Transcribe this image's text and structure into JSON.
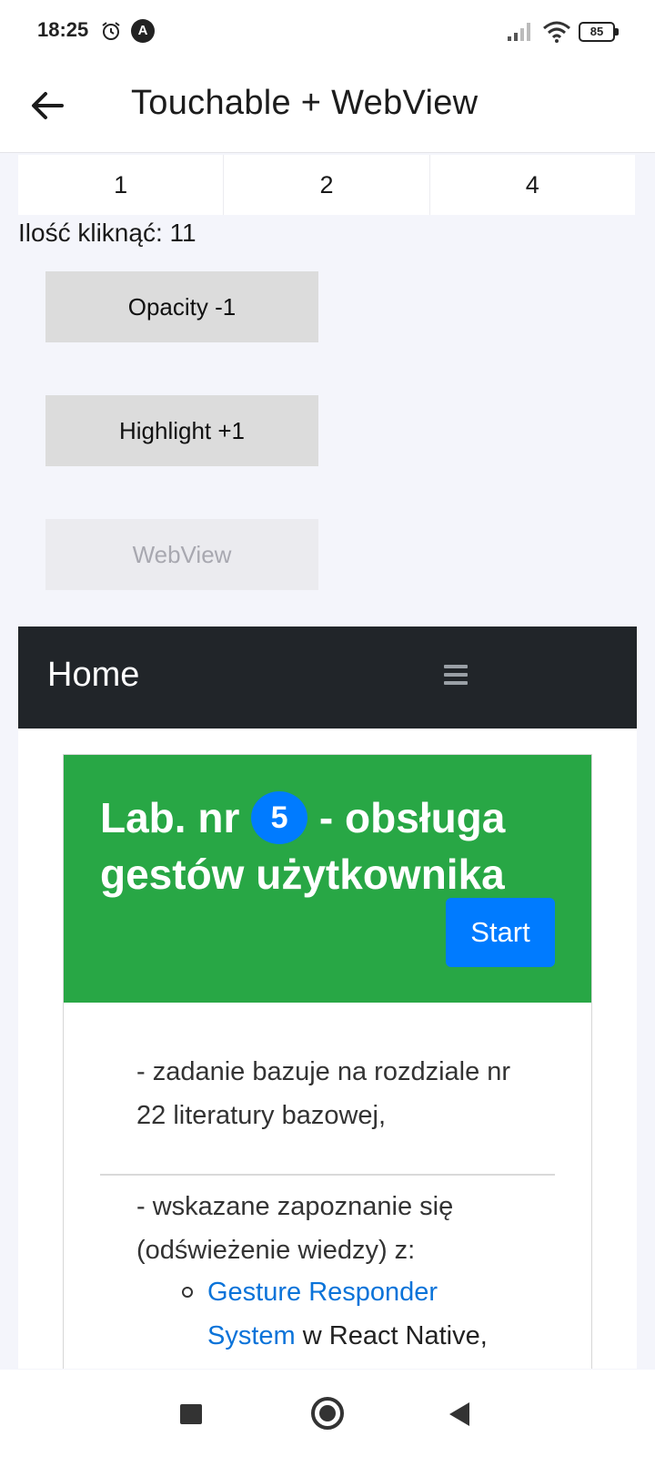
{
  "status_bar": {
    "time": "18:25",
    "a_badge": "A",
    "battery": "85",
    "icons": [
      "alarm-icon",
      "a-app-icon",
      "signal-icon",
      "wifi-icon",
      "battery-icon"
    ]
  },
  "header": {
    "title": "Touchable + WebView",
    "back_icon": "arrow-left-icon"
  },
  "tabs": [
    "1",
    "2",
    "4"
  ],
  "counter": "Ilość kliknąć: 11",
  "buttons": {
    "opacity": "Opacity -1",
    "highlight": "Highlight +1",
    "webview": "WebView"
  },
  "webview": {
    "nav_title": "Home",
    "menu_icon": "hamburger-icon",
    "card": {
      "title_before": "Lab. nr ",
      "badge": "5",
      "title_after": " - obsługa gestów użytkownika",
      "start_label": "Start",
      "item1": "- zadanie bazuje na rozdziale nr 22 literatury bazowej,",
      "item2": "- wskazane zapoznanie się (odświeżenie wiedzy) z:",
      "sub_link": "Gesture Responder System",
      "sub_text": " w React Native,"
    }
  },
  "colors": {
    "accent_green": "#28a745",
    "accent_blue": "#007bff",
    "nav_dark": "#212529",
    "link": "#0a73d9"
  },
  "system_nav": {
    "icons": [
      "recents-square-icon",
      "home-circle-icon",
      "back-triangle-icon"
    ]
  }
}
